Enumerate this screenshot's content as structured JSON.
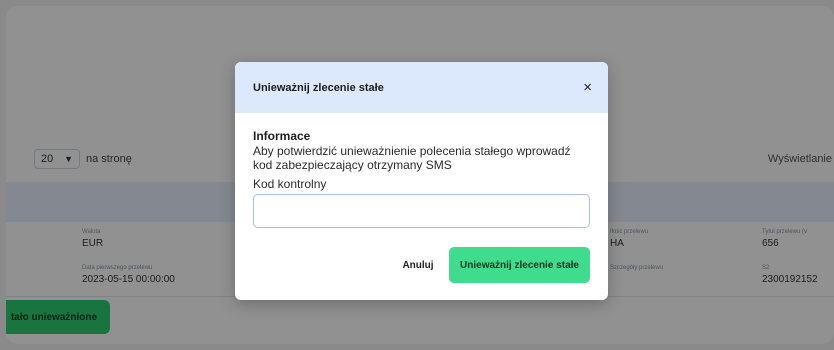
{
  "pagination": {
    "per_page_value": "20",
    "per_page_label": "na stronę",
    "display_label": "Wyświetlanie"
  },
  "table": {
    "row1": [
      {
        "label": "Waluta",
        "value": "EUR"
      },
      {
        "label": "Ilość przelewu",
        "value": "HA"
      },
      {
        "label": "Tytuł przelewu (v",
        "value": "656"
      }
    ],
    "row2": [
      {
        "label": "Data pierwszego przelewu",
        "value": "2023-05-15 00:00:00"
      },
      {
        "label": "Szczegóły przelewu",
        "value": ""
      },
      {
        "label": "S2",
        "value": "2300192152"
      }
    ]
  },
  "background_button_label": "tało unieważnione",
  "modal": {
    "title": "Unieważnij zlecenie stałe",
    "close_symbol": "×",
    "info_heading": "Informace",
    "info_text": "Aby potwierdzić unieważnienie polecenia stałego wprowadź kod zabezpieczający otrzymany SMS",
    "code_label": "Kod kontrolny",
    "code_value": "",
    "cancel_label": "Anuluj",
    "confirm_label": "Unieważnij zlecenie stałe"
  },
  "colors": {
    "modal_header": "#dce8fb",
    "confirm_button": "#3fdc8d",
    "background_button": "#2ecc71",
    "table_header": "#e9f1ff"
  }
}
